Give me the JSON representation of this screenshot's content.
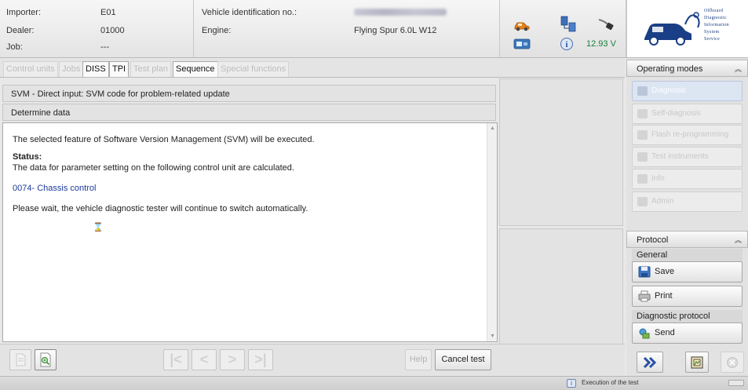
{
  "header": {
    "importer_label": "Importer:",
    "importer_value": "E01",
    "dealer_label": "Dealer:",
    "dealer_value": "01000",
    "job_label": "Job:",
    "job_value": "---",
    "vin_label": "Vehicle identification no.:",
    "engine_label": "Engine:",
    "engine_value": "Flying Spur 6.0L W12",
    "voltage": "12.93 V",
    "logo": {
      "lines": [
        "Offboard",
        "Diagnostic",
        "Information",
        "System",
        "Service"
      ]
    }
  },
  "tabs": [
    {
      "label": "Control units",
      "active": false
    },
    {
      "label": "Jobs",
      "active": false
    },
    {
      "label": "DISS",
      "active": true
    },
    {
      "label": "TPI",
      "active": true
    },
    {
      "label": "Test plan",
      "active": false
    },
    {
      "label": "Sequence",
      "active": true
    },
    {
      "label": "Special functions",
      "active": false
    }
  ],
  "main": {
    "title": "SVM - Direct input: SVM code for problem-related update",
    "section": "Determine data",
    "line1": "The selected feature of Software Version Management (SVM) will be executed.",
    "status_label": "Status:",
    "status_text": "The data for parameter setting on the following control unit are calculated.",
    "control_unit": "0074- Chassis control",
    "wait_text": "Please wait, the vehicle diagnostic tester will continue to switch automatically.",
    "hourglass": "⌛"
  },
  "toolbar": {
    "help_label": "Help",
    "cancel_label": "Cancel test"
  },
  "operating_modes": {
    "header": "Operating modes",
    "items": [
      {
        "label": "Diagnosis",
        "icon": "diagnosis-icon"
      },
      {
        "label": "Self-diagnosis",
        "icon": "self-diagnosis-icon"
      },
      {
        "label": "Flash re-programming",
        "icon": "flash-icon"
      },
      {
        "label": "Test instruments",
        "icon": "test-instruments-icon"
      },
      {
        "label": "Info",
        "icon": "info-icon"
      },
      {
        "label": "Admin",
        "icon": "admin-icon"
      }
    ]
  },
  "protocol": {
    "header": "Protocol",
    "general_label": "General",
    "save_label": "Save",
    "print_label": "Print",
    "diagnostic_label": "Diagnostic protocol",
    "send_label": "Send"
  },
  "status_bar": {
    "text": "Execution of the test"
  },
  "colors": {
    "link_blue": "#1d3a9c",
    "voltage_green": "#16803a",
    "logo_blue": "#1b3f86"
  }
}
